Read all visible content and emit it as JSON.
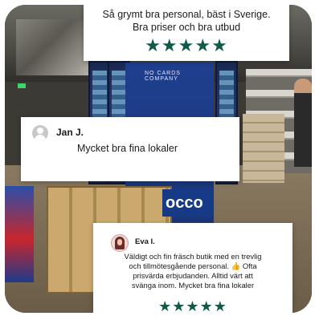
{
  "reviews": [
    {
      "author": "",
      "text_line1": "Så grymt bra personal, bäst i Sverige.",
      "text_line2": "Bra priser och bra utbud",
      "stars": "★★★★★",
      "rating": 5
    },
    {
      "author": "Jan J.",
      "text": "Mycket bra fina lokaler",
      "avatar_icon": "user-placeholder-icon"
    },
    {
      "author": "Eva I.",
      "text_line1": "Väldigt och fin fräsch butik med en trevlig",
      "text_line2": "och tillmötesgående personal. 👍 Ofta",
      "text_line3": "prisvärda erbjudanden. Alltid värt att",
      "text_line4": "svänga inom. Mycket bra fina lokaler",
      "stars": "★★★★★",
      "rating": 5,
      "avatar_icon": "woman-avatar-icon"
    }
  ],
  "background": {
    "store_sign_small": "NO CARDS COMPANY",
    "store_sign_large": "occo"
  },
  "colors": {
    "star": "#12594a",
    "card_bg": "#ffffff"
  }
}
